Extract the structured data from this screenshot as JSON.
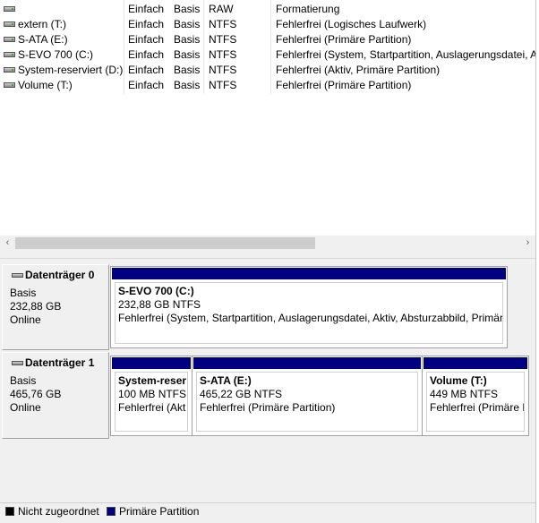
{
  "volumes": [
    {
      "name": "",
      "layout": "Einfach",
      "type": "Basis",
      "fs": "RAW",
      "status": "Formatierung"
    },
    {
      "name": "extern (T:)",
      "layout": "Einfach",
      "type": "Basis",
      "fs": "NTFS",
      "status": "Fehlerfrei (Logisches Laufwerk)"
    },
    {
      "name": "S-ATA (E:)",
      "layout": "Einfach",
      "type": "Basis",
      "fs": "NTFS",
      "status": "Fehlerfrei (Primäre Partition)"
    },
    {
      "name": "S-EVO 700 (C:)",
      "layout": "Einfach",
      "type": "Basis",
      "fs": "NTFS",
      "status": "Fehlerfrei (System, Startpartition, Auslagerungsdatei, A"
    },
    {
      "name": "System-reserviert (D:)",
      "layout": "Einfach",
      "type": "Basis",
      "fs": "NTFS",
      "status": "Fehlerfrei (Aktiv, Primäre Partition)"
    },
    {
      "name": "Volume (T:)",
      "layout": "Einfach",
      "type": "Basis",
      "fs": "NTFS",
      "status": "Fehlerfrei (Primäre Partition)"
    }
  ],
  "scrollbar": {
    "left_icon": "‹",
    "right_icon": "›"
  },
  "disks": [
    {
      "title": "Datenträger 0",
      "type": "Basis",
      "size": "232,88 GB",
      "state": "Online",
      "partitions": [
        {
          "name": "S-EVO 700  (C:)",
          "size": "232,88 GB NTFS",
          "status": "Fehlerfrei (System, Startpartition, Auslagerungsdatei, Aktiv, Absturzabbild, Primär"
        }
      ]
    },
    {
      "title": "Datenträger 1",
      "type": "Basis",
      "size": "465,76 GB",
      "state": "Online",
      "partitions": [
        {
          "name": "System-reser",
          "size": "100 MB NTFS",
          "status": "Fehlerfrei (Akt"
        },
        {
          "name": "S-ATA  (E:)",
          "size": "465,22 GB NTFS",
          "status": "Fehlerfrei (Primäre Partition)"
        },
        {
          "name": "Volume  (T:)",
          "size": "449 MB NTFS",
          "status": "Fehlerfrei (Primäre P"
        }
      ]
    }
  ],
  "legend": [
    {
      "label": "Nicht zugeordnet",
      "color": "#000000"
    },
    {
      "label": "Primäre Partition",
      "color": "#000080"
    }
  ],
  "colors": {
    "primary_partition": "#000080",
    "unallocated": "#000000"
  }
}
